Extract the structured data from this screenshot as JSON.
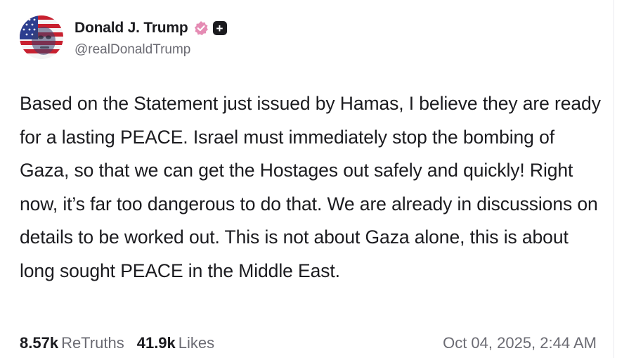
{
  "author": {
    "display_name": "Donald J. Trump",
    "handle": "@realDonaldTrump",
    "verified_icon": "verified-badge-icon",
    "verified_color": "#e58cb4",
    "follow_icon": "plus-icon"
  },
  "post": {
    "text": "Based on the Statement just issued by Hamas, I believe they are ready for a lasting PEACE. Israel must immediately stop the bombing of Gaza, so that we can get the Hostages out safely and quickly! Right now, it’s far too dangerous to do that. We are already in discussions on details to be worked out. This is not about Gaza alone, this is about long sought PEACE in the Middle East."
  },
  "stats": {
    "retruths_count": "8.57k",
    "retruths_label": "ReTruths",
    "likes_count": "41.9k",
    "likes_label": "Likes"
  },
  "timestamp": "Oct 04, 2025, 2:44 AM"
}
